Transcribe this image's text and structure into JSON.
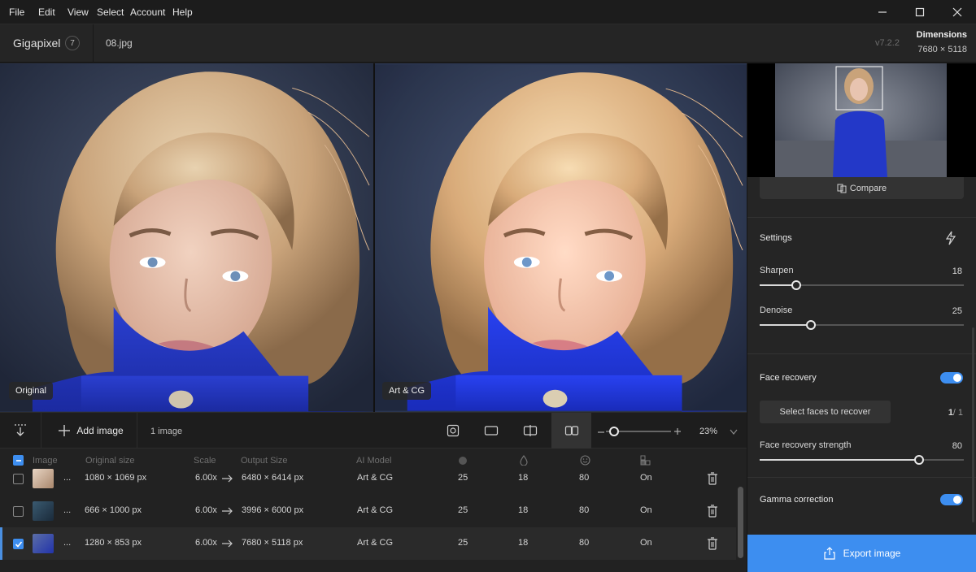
{
  "menu": [
    "File",
    "Edit",
    "View",
    "Select",
    "Account",
    "Help"
  ],
  "header": {
    "app_name": "Gigapixel",
    "badge": "7",
    "filename": "08.jpg",
    "version": "v7.2.2",
    "dimensions_label": "Dimensions",
    "dimensions_value": "7680 × 5118"
  },
  "preview": {
    "left_label": "Original",
    "right_label": "Art & CG"
  },
  "toolbar": {
    "add_image": "Add image",
    "image_count": "1 image",
    "zoom": "23%",
    "zoom_fraction": 0.12
  },
  "table": {
    "headers": {
      "image": "Image",
      "original_size": "Original size",
      "scale": "Scale",
      "output_size": "Output Size",
      "ai_model": "AI Model"
    },
    "rows": [
      {
        "ellipsis": "...",
        "original": "1080 × 1069 px",
        "scale": "6.00x",
        "output": "6480 × 6414 px",
        "model": "Art & CG",
        "denoise": "25",
        "sharpen": "18",
        "face": "80",
        "gamma": "On",
        "checked": false
      },
      {
        "ellipsis": "...",
        "original": "666 × 1000 px",
        "scale": "6.00x",
        "output": "3996 × 6000 px",
        "model": "Art & CG",
        "denoise": "25",
        "sharpen": "18",
        "face": "80",
        "gamma": "On",
        "checked": false
      },
      {
        "ellipsis": "...",
        "original": "1280 × 853 px",
        "scale": "6.00x",
        "output": "7680 × 5118 px",
        "model": "Art & CG",
        "denoise": "25",
        "sharpen": "18",
        "face": "80",
        "gamma": "On",
        "checked": true
      }
    ]
  },
  "panel": {
    "compare": "Compare",
    "settings": "Settings",
    "sharpen_label": "Sharpen",
    "sharpen_value": "18",
    "sharpen_fraction": 0.18,
    "denoise_label": "Denoise",
    "denoise_value": "25",
    "denoise_fraction": 0.25,
    "face_recovery": "Face recovery",
    "select_faces": "Select faces to recover",
    "faces_count": "1",
    "faces_total": "/ 1",
    "face_strength_label": "Face recovery strength",
    "face_strength_value": "80",
    "face_strength_fraction": 0.78,
    "gamma": "Gamma correction",
    "export": "Export image"
  },
  "colors": {
    "accent": "#3d8ef0",
    "background": "#1e1e1e",
    "panel": "#252525"
  }
}
